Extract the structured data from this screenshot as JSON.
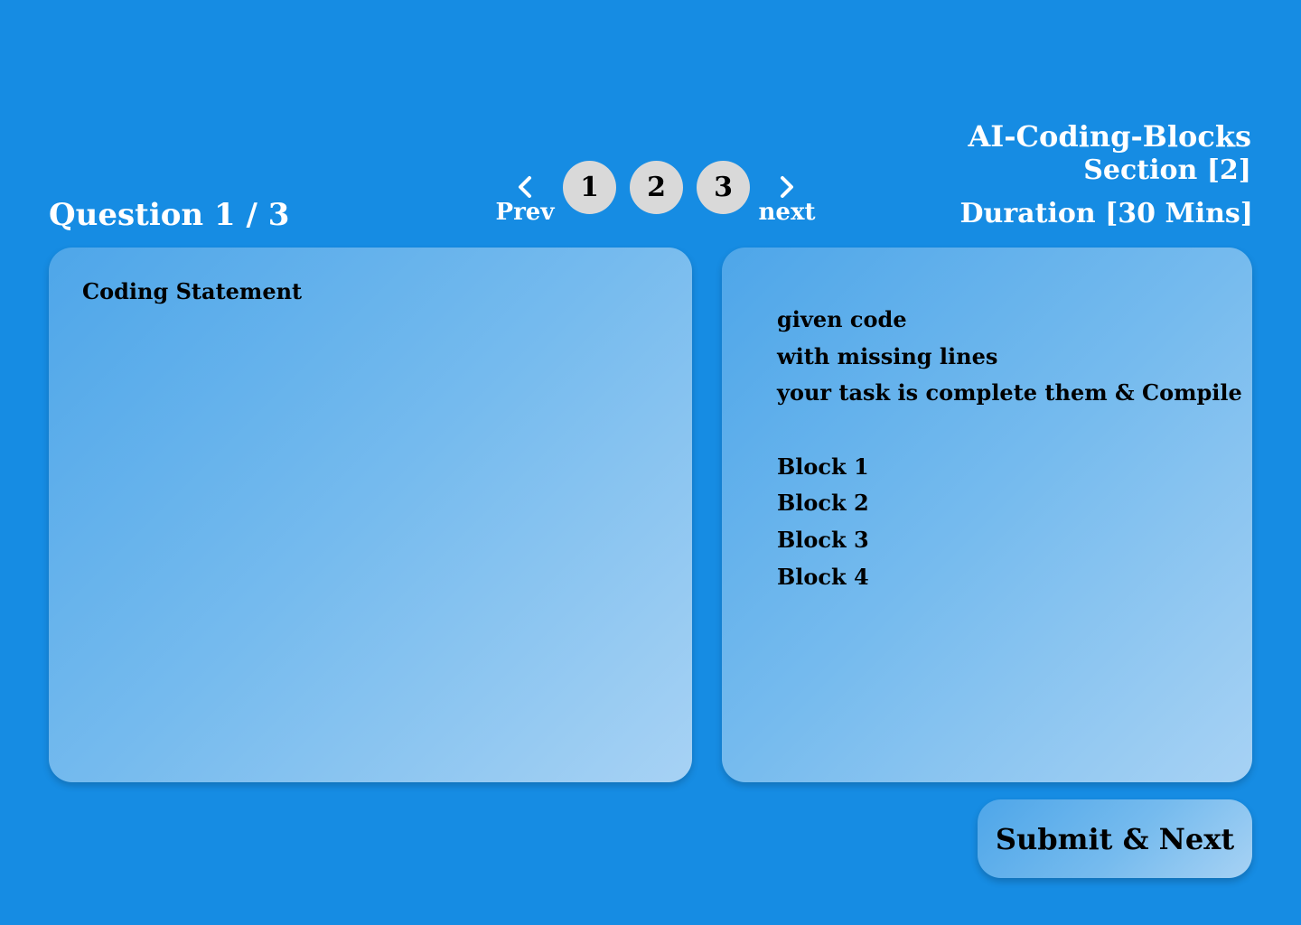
{
  "header": {
    "question_counter": "Question 1 / 3",
    "app_title": "AI-Coding-Blocks",
    "section": "Section [2]",
    "duration": "Duration [30 Mins]"
  },
  "pagination": {
    "prev_label": "Prev",
    "prev_icon": "chevron-left-icon",
    "next_label": "next",
    "next_icon": "chevron-right-icon",
    "pages": [
      "1",
      "2",
      "3"
    ]
  },
  "statement_panel": {
    "label": "Coding Statement"
  },
  "code_panel": {
    "lines": [
      "given code",
      "with missing lines",
      "your task is complete them & Compile",
      "",
      "Block 1",
      "Block 2",
      "Block 3",
      "Block 4"
    ]
  },
  "actions": {
    "submit_label": "Submit & Next"
  },
  "colors": {
    "background": "#168CE3",
    "page_button": "#D9D9D9",
    "panel_gradient_start": "#4EA6E9",
    "panel_gradient_end": "#A7D2F4"
  }
}
